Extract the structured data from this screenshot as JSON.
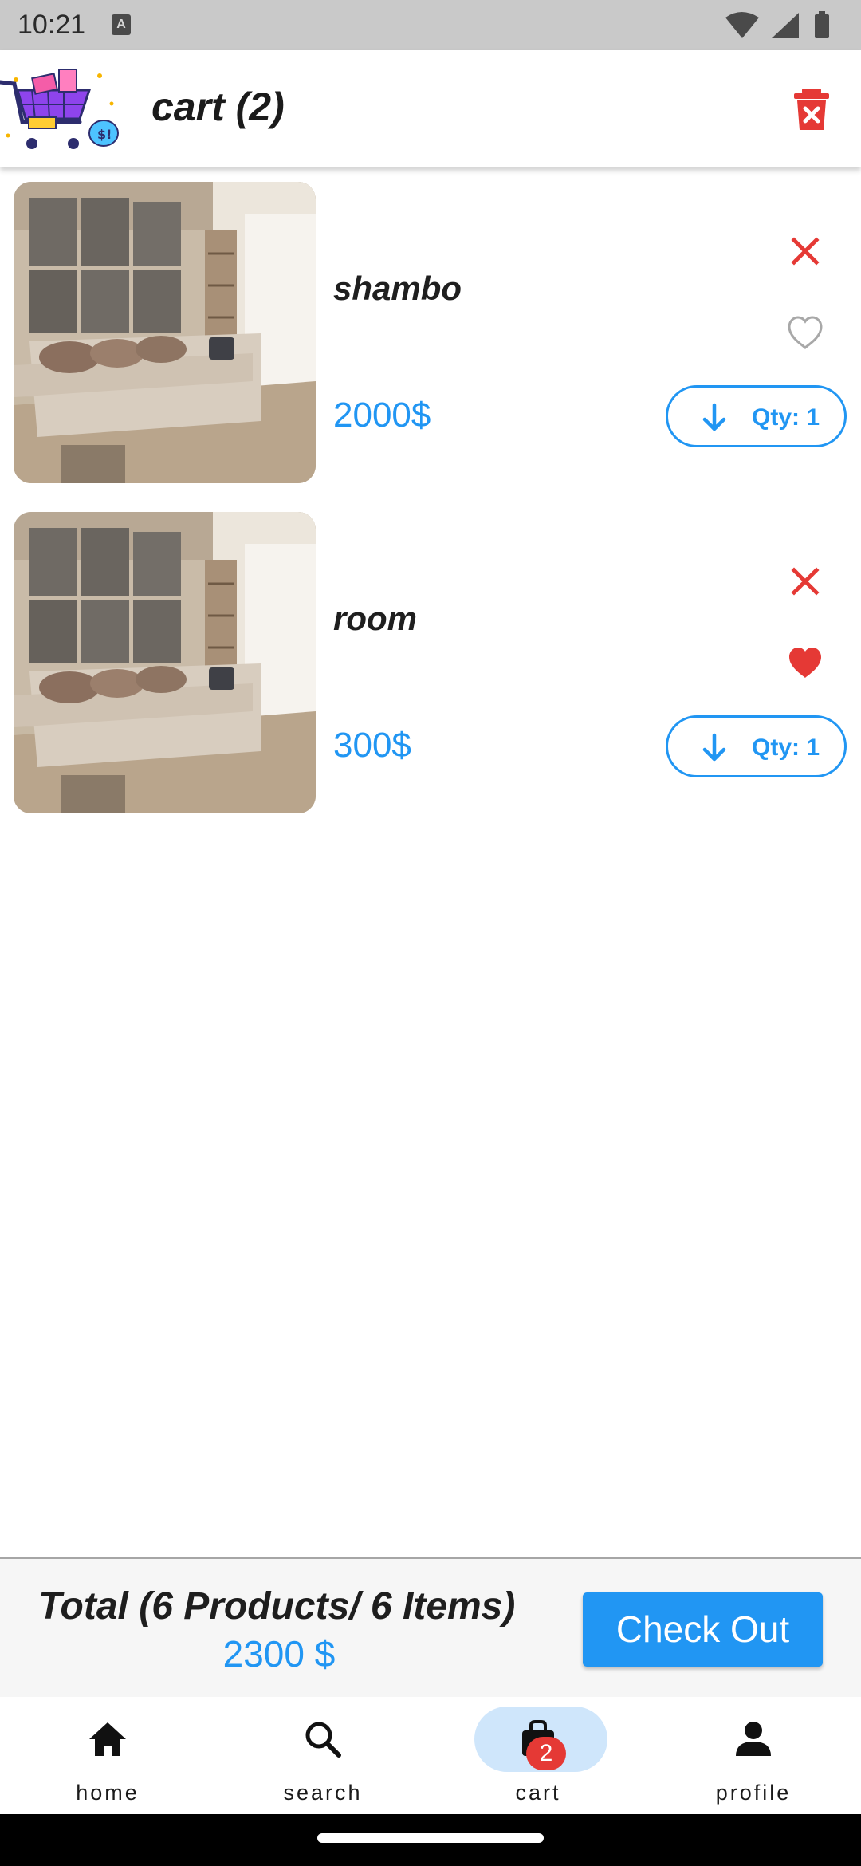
{
  "status_bar": {
    "time": "10:21",
    "notif_icon": "A"
  },
  "app_bar": {
    "title": "cart (2)"
  },
  "cart_items": [
    {
      "name": "shambo",
      "price": "2000$",
      "qty_label": "Qty: 1",
      "favorite": false
    },
    {
      "name": "room",
      "price": "300$",
      "qty_label": "Qty: 1",
      "favorite": true
    }
  ],
  "footer": {
    "total_label": "Total (6 Products/ 6 Items)",
    "total_amount": "2300 $",
    "checkout_label": "Check Out"
  },
  "bottom_nav": {
    "items": [
      {
        "label": "home",
        "icon": "home-icon"
      },
      {
        "label": "search",
        "icon": "search-icon"
      },
      {
        "label": "cart",
        "icon": "shopping-bag-icon",
        "selected": true
      },
      {
        "label": "profile",
        "icon": "person-icon"
      }
    ],
    "cart_badge": "2"
  },
  "colors": {
    "accent": "#2196f3",
    "danger": "#e53935",
    "nav_selected_bg": "#cfe6fb"
  }
}
